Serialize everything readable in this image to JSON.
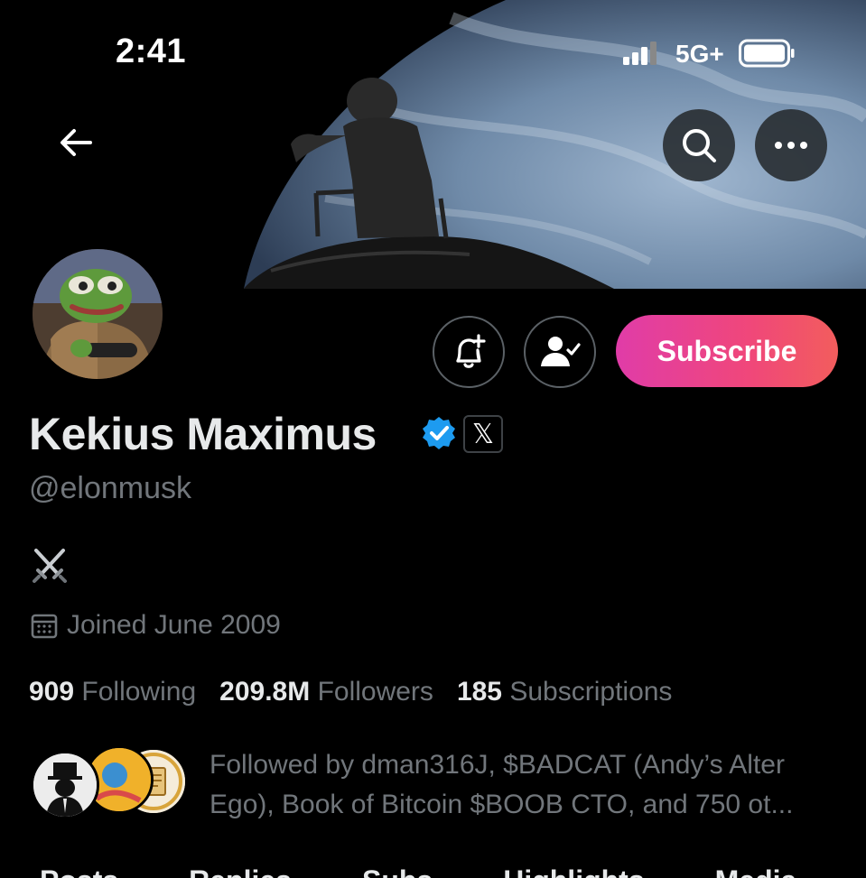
{
  "status_bar": {
    "time": "2:41",
    "network": "5G+"
  },
  "profile": {
    "display_name": "Kekius Maximus",
    "handle": "@elonmusk",
    "bio_icon": "crossed-swords-icon",
    "joined": "Joined June 2009",
    "subscribe_label": "Subscribe",
    "x_badge": "𝕏"
  },
  "stats": {
    "following_count": "909",
    "following_label": "Following",
    "followers_count": "209.8M",
    "followers_label": "Followers",
    "subscriptions_count": "185",
    "subscriptions_label": "Subscriptions"
  },
  "followed_by": {
    "line1": "Followed by dman316J, $BADCAT (Andy’s Alter",
    "line2": "Ego), Book of Bitcoin $BOOB CTO, and 750 ot..."
  },
  "tabs": [
    "Posts",
    "Replies",
    "Subs",
    "Highlights",
    "Media"
  ],
  "colors": {
    "background": "#000000",
    "verified": "#1d9bf0",
    "subscribe_gradient_start": "#e03ca8",
    "subscribe_gradient_end": "#f25d5d",
    "muted_text": "#71767b",
    "primary_text": "#e7e9ea"
  }
}
